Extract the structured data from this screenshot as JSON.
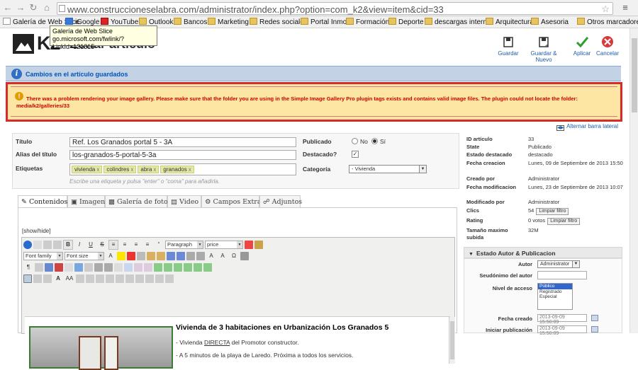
{
  "browser": {
    "url": "www.construccioneselabra.com/administrator/index.php?option=com_k2&view=item&cid=33",
    "bookmarks": [
      {
        "label": "Galería de Web Slice",
        "icon": "page-icon"
      },
      {
        "label": "iGoogle",
        "icon": "google-icon"
      },
      {
        "label": "YouTube",
        "icon": "youtube-icon"
      },
      {
        "label": "Outlook",
        "icon": "folder-icon"
      },
      {
        "label": "Bancos",
        "icon": "folder-icon"
      },
      {
        "label": "Marketing",
        "icon": "folder-icon"
      },
      {
        "label": "Redes sociales",
        "icon": "folder-icon"
      },
      {
        "label": "Portal Inmob",
        "icon": "folder-icon"
      },
      {
        "label": "Formación",
        "icon": "folder-icon"
      },
      {
        "label": "Deporte",
        "icon": "folder-icon"
      },
      {
        "label": "descargas internet",
        "icon": "folder-icon"
      },
      {
        "label": "Arquitectura",
        "icon": "folder-icon"
      },
      {
        "label": "Asesoria",
        "icon": "folder-icon"
      },
      {
        "label": "Otros marcadores",
        "icon": "folder-icon"
      }
    ],
    "tooltip": {
      "line1": "Galería de Web Slice",
      "line2": "go.microsoft.com/fwlink/?LinkId=121315"
    }
  },
  "header": {
    "logo_text": "K2",
    "title": "Editar artículo",
    "toolbar": {
      "save": "Guardar",
      "save_new": "Guardar & Nuevo",
      "apply": "Aplicar",
      "cancel": "Cancelar"
    }
  },
  "messages": {
    "info": "Cambios en el artículo guardados",
    "error": "There was a problem rendering your image gallery. Please make sure that the folder you are using in the Simple Image Gallery Pro plugin tags exists and contains valid image files. The plugin could not locate the folder: media/k2/galleries/33"
  },
  "toggle_sidebar": "Alternar barra lateral",
  "form": {
    "title_label": "Título",
    "title_value": "Ref. Los Granados portal 5 - 3A",
    "alias_label": "Alias del título",
    "alias_value": "los-granados-5-portal-5-3a",
    "tags_label": "Etiquetas",
    "tags": [
      "vivienda",
      "colindres",
      "abra",
      "granados"
    ],
    "tags_hint": "Escribe una etiqueta y pulsa \"enter\" o \"coma\" para añadirla.",
    "published_label": "Publicado",
    "published_no": "No",
    "published_yes": "Sí",
    "featured_label": "Destacado?",
    "category_label": "Categoría",
    "category_value": "- Vivienda"
  },
  "tabs": [
    "Contenidos",
    "Imagen",
    "Galería de fotos",
    "Video",
    "Campos Extra",
    "Adjuntos"
  ],
  "editor": {
    "showhide": "[show/hide]",
    "format": "Paragraph",
    "style": "price",
    "font_family": "Font family",
    "font_size": "Font size",
    "heading": "Vivienda de 3 habitaciones en Urbanización Los Granados 5",
    "p1_pre": "- Vivienda ",
    "p1_link": "DIRECTA",
    "p1_post": " del Promotor constructor.",
    "p2": "- A 5 minutos de la playa de Laredo. Próxima a todos los servicios."
  },
  "sidebar": {
    "rows": [
      {
        "k": "ID artículo",
        "v": "33"
      },
      {
        "k": "State",
        "v": "Publicado"
      },
      {
        "k": "Estado destacado",
        "v": "destacado"
      },
      {
        "k": "Fecha creacion",
        "v": "Lunes, 09 de Septiembre de 2013 15:50"
      },
      {
        "k": "Creado por",
        "v": "Administrator"
      },
      {
        "k": "Fecha modificacion",
        "v": "Lunes, 23 de Septiembre de 2013 10:07"
      },
      {
        "k": "Modificado por",
        "v": "Administrator"
      },
      {
        "k": "Clics",
        "v": "54"
      },
      {
        "k": "Rating",
        "v": "0 votos"
      },
      {
        "k": "Tamaño maximo subida",
        "v": "32M"
      }
    ],
    "reset_hits": "Limpiar filtro",
    "reset_rating": "Limpiar filtro",
    "panel_title": "Estado Autor & Publicacion",
    "author_label": "Autor",
    "author_value": "Administrator",
    "alias_author_label": "Seudónimo del autor",
    "access_label": "Nivel de acceso",
    "access_options": [
      "Público",
      "Registrado",
      "Especial"
    ],
    "created_label": "Fecha creado",
    "created_value": "2013-09-09 15:50:09",
    "publish_label": "Iniciar publicación",
    "publish_value": "2013-09-09 15:50:09"
  }
}
